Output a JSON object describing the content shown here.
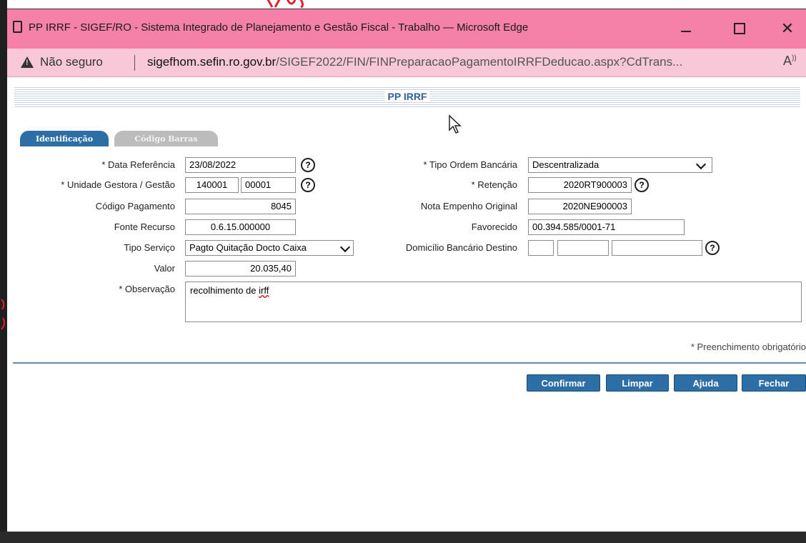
{
  "window": {
    "title": "PP IRRF - SIGEF/RO - Sistema Integrado de Planejamento e Gestão Fiscal - Trabalho — Microsoft Edge",
    "minimize": "—",
    "maximize": "☐",
    "close": "✕"
  },
  "address_bar": {
    "security_label": "Não seguro",
    "url_host": "sigefhom.sefin.ro.gov.br",
    "url_path": "/SIGEF2022/FIN/FINPreparacaoPagamentoIRRFDeducao.aspx?CdTrans...",
    "read_aloud": "A⁾"
  },
  "page": {
    "title": "PP IRRF",
    "tabs": [
      {
        "label": "Identificação",
        "active": true
      },
      {
        "label": "Código Barras",
        "active": false
      }
    ]
  },
  "form": {
    "data_referencia": {
      "label": "* Data Referência",
      "value": "23/08/2022"
    },
    "unidade_gestora": {
      "label": "* Unidade Gestora / Gestão",
      "value_ug": "140001",
      "value_gestao": "00001"
    },
    "codigo_pagamento": {
      "label": "Código Pagamento",
      "value": "8045"
    },
    "fonte_recurso": {
      "label": "Fonte Recurso",
      "value": "0.6.15.000000"
    },
    "tipo_servico": {
      "label": "Tipo Serviço",
      "value": "Pagto Quitação Docto Caixa"
    },
    "valor": {
      "label": "Valor",
      "value": "20.035,40"
    },
    "observacao": {
      "label": "* Observação",
      "value_prefix": "recolhimento de ",
      "value_misspelled": "irff"
    },
    "tipo_ordem_bancaria": {
      "label": "* Tipo Ordem Bancária",
      "value": "Descentralizada"
    },
    "retencao": {
      "label": "* Retenção",
      "value": "2020RT900003"
    },
    "nota_empenho_original": {
      "label": "Nota Empenho Original",
      "value": "2020NE900003"
    },
    "favorecido": {
      "label": "Favorecido",
      "value": "00.394.585/0001-71"
    },
    "domicilio_bancario_destino": {
      "label": "Domicílio Bancário Destino",
      "banco": "",
      "agencia": "",
      "conta": ""
    },
    "help_glyph": "?"
  },
  "required_note": "* Preenchimento obrigatório",
  "buttons": {
    "confirm": "Confirmar",
    "clear": "Limpar",
    "help": "Ajuda",
    "close": "Fechar"
  },
  "colors": {
    "title_bar": "#f580a8",
    "address_bar": "#f8c7d8",
    "accent_blue": "#2d6ea6",
    "tab_inactive": "#bcbcbc"
  }
}
